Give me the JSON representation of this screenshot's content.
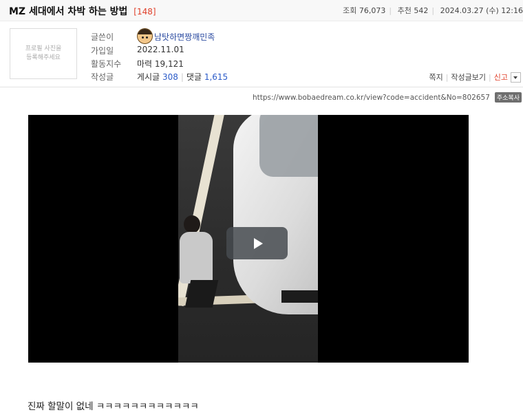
{
  "post": {
    "title": "MZ 세대에서 차박 하는 방법",
    "comment_count": "[148]",
    "views_label": "조회",
    "views": "76,073",
    "recommend_label": "추천",
    "recommend": "542",
    "date": "2024.03.27 (수) 12:16"
  },
  "author": {
    "photo_placeholder_line1": "프로필 사진을",
    "photo_placeholder_line2": "등록해주세요",
    "writer_label": "글쓴이",
    "name": "남탓하면짱깨민족",
    "joined_label": "가입일",
    "joined": "2022.11.01",
    "activity_label": "활동지수",
    "activity_prefix": "마력",
    "activity": "19,121",
    "posts_label": "작성글",
    "posts_prefix": "게시글",
    "posts_count": "308",
    "comments_prefix": "댓글",
    "comments_count": "1,615"
  },
  "actions": {
    "message": "쪽지",
    "view_posts": "작성글보기",
    "report": "신고"
  },
  "url": {
    "text": "https://www.bobaedream.co.kr/view?code=accident&No=802657",
    "copy_label": "주소복사"
  },
  "video": {
    "play_icon": "play-icon"
  },
  "body": {
    "text": "진짜 할말이 없네 ㅋㅋㅋㅋㅋㅋㅋㅋㅋㅋㅋㅋ"
  },
  "colors": {
    "comment_count": "#e0402a",
    "report": "#e0402a",
    "link_number": "#2a5ac8",
    "author": "#2a4aa0"
  }
}
